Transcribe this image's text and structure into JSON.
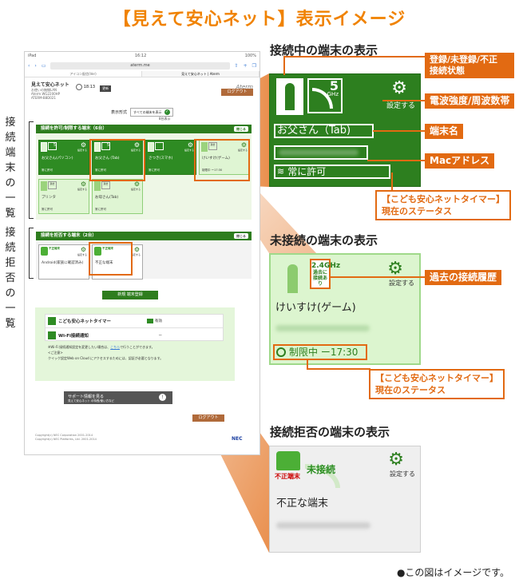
{
  "main_title": "【見えて安心ネット】表示イメージ",
  "note": "●この図はイメージです。",
  "left_labels": {
    "group1": "接続端末の一覧",
    "group2": "接続拒否の一覧"
  },
  "tablet": {
    "status_left": "iPad",
    "status_time": "16:12",
    "status_right": "100%",
    "url": "aterm.me",
    "tabs": [
      "アイコン配信(Ver)",
      "見えて安心ネット | Aterm"
    ],
    "page_title": "見えて安心ネット",
    "page_sub1": "お使いの無線LAN",
    "page_sub2": "Aterm WG2200HP",
    "page_sub3": "ATERM-B8D021",
    "clock": "18:13",
    "update_btn": "更新",
    "logo": "Aterm",
    "logout": "ログアウト",
    "filter_label": "表示形式",
    "filter_value": "すべての端末を表示",
    "count_text": "8台表示",
    "allow_header": "接続を許可/制限する端末（6台）",
    "deny_header": "接続を拒否する端末（2台）",
    "close_btn": "閉じる",
    "gear_label": "設定する",
    "allow_devices": [
      {
        "name": "お父さん(パソコン)",
        "status": "常に許可"
      },
      {
        "name": "お父さん (Tab)",
        "status": "常に許可"
      },
      {
        "name": "さつき(スマホ)",
        "status": "常に許可"
      },
      {
        "name": "けいすけ(ゲーム)",
        "status": "制限中 ー17:30"
      },
      {
        "name": "プリンタ",
        "status": "常に許可"
      },
      {
        "name": "お母さん(Tab)",
        "status": "常に許可"
      }
    ],
    "deny_devices": [
      {
        "name": "Android(家族に確認済み)",
        "tag": "不正端末"
      },
      {
        "name": "不正な端末",
        "tag": "不正端末"
      }
    ],
    "add_btn": "新規 端末登録",
    "timer_label": "こども安心ネットタイマー",
    "timer_value": "有効",
    "wifi_label": "Wi-Fi接続通知",
    "wifi_value": "ー",
    "sub_note1": "※Wi-Fi 接続通知設定を変更したい場合は、",
    "sub_note_link": "こちら",
    "sub_note1b": "で行うことができます。",
    "sub_note2": "<ご注意>",
    "sub_note3": "クイック設定Web on Cloud にアクセスするためには、認証が必要となります。",
    "support_btn": "サポート情報を見る",
    "support_sub": "見えて安心ネット の特長/使い方など",
    "copyright1": "Copyright(c) NEC Corporation 2001-2014",
    "copyright2": "Copyright(c) NEC Platforms, Ltd. 2001-2014",
    "nec": "NEC"
  },
  "panel_connected": {
    "heading": "接続中の端末の表示",
    "wifi_num": "5",
    "wifi_unit": "GHz",
    "gear_label": "設定する",
    "name": "お父さん（Tab)",
    "status": "常に許可"
  },
  "panel_disconnected": {
    "heading": "未接続の端末の表示",
    "band": "2.4GHz",
    "hist_line1": "過去に",
    "hist_line2": "接続あり",
    "gear_label": "設定する",
    "name": "けいすけ(ゲーム)",
    "status": "制限中 ー17:30"
  },
  "panel_denied": {
    "heading": "接続拒否の端末の表示",
    "tag": "不正端末",
    "conn": "未接続",
    "gear_label": "設定する",
    "name": "不正な端末"
  },
  "callouts": {
    "reg": "登録/未登録/不正\n接続状態",
    "signal": "電波強度/周波数帯",
    "name": "端末名",
    "mac": "Macアドレス",
    "timer_status1": "【こども安心ネットタイマー】\n現在のステータス",
    "history": "過去の接続履歴",
    "timer_status2": "【こども安心ネットタイマー】\n現在のステータス"
  },
  "colors": {
    "accent": "#f08200",
    "callout": "#e26a12",
    "green": "#2d7f1f",
    "light_green": "#dcf5cf"
  }
}
